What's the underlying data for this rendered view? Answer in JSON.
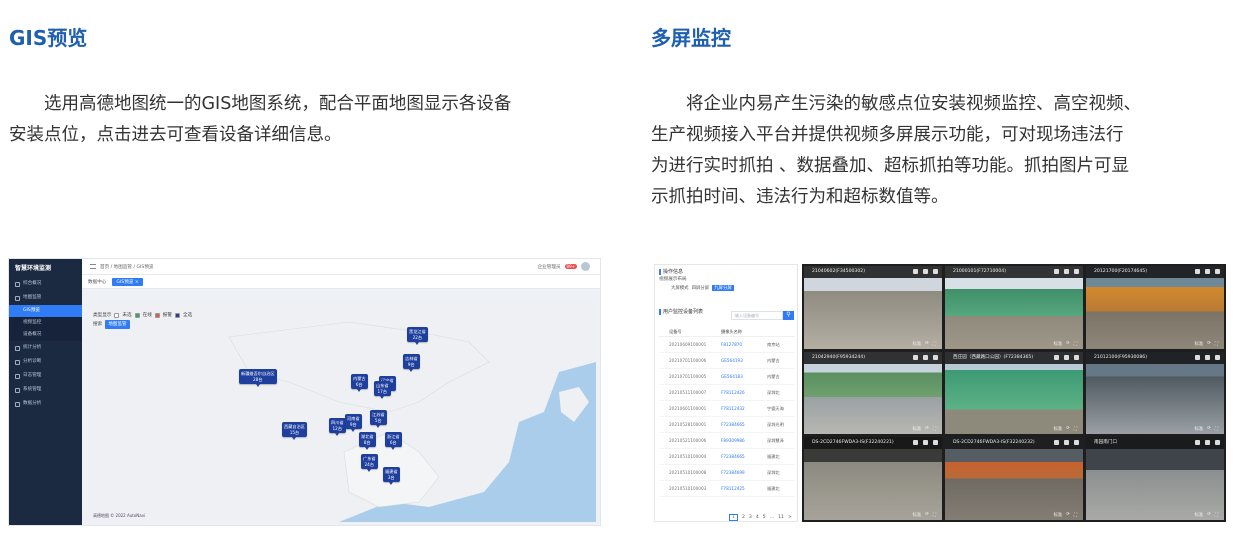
{
  "sections": {
    "gis": {
      "title": "GIS预览",
      "desc_line1": "选用高德地图统一的GIS地图系统，配合平面地图显示各设备",
      "desc_line2": "安装点位，点击进去可查看设备详细信息。"
    },
    "multi": {
      "title": "多屏监控",
      "desc_line1": "将企业内易产生污染的敏感点位安装视频监控、高空视频、",
      "desc_line2": "生产视频接入平台并提供视频多屏展示功能，可对现场违法行",
      "desc_line3": "为进行实时抓拍 、数据叠加、超标抓拍等功能。抓拍图片可显",
      "desc_line4": "示抓拍时间、违法行为和超标数值等。"
    }
  },
  "gis_ui": {
    "logo": "智慧环境监测",
    "menu": [
      {
        "label": "综合概况"
      },
      {
        "label": "地图监管"
      },
      {
        "label": "GIS预览",
        "sub": true,
        "active": true
      },
      {
        "label": "视频监控",
        "sub": true
      },
      {
        "label": "设备概况",
        "sub": true
      },
      {
        "label": "统计分析"
      },
      {
        "label": "分析诊断"
      },
      {
        "label": "日志管理"
      },
      {
        "label": "系统管理"
      },
      {
        "label": "数据分析"
      }
    ],
    "breadcrumb": "首页 / 地图监管 / GIS预览",
    "topbar_user": "企业管理员",
    "topbar_badge": "99+",
    "tab_home": "数据中心",
    "tab_active": "GIS预览 ×",
    "filter_label": "类型显示",
    "filter_items": [
      "未选",
      "在线",
      "报警",
      "全选"
    ],
    "filter_label2": "搜索",
    "filter_btn": "地图监管",
    "markers": [
      {
        "l1": "黑龙江省",
        "l2": "22台"
      },
      {
        "l1": "吉林省",
        "l2": "9台"
      },
      {
        "l1": "新疆维吾尔自治区",
        "l2": "28台"
      },
      {
        "l1": "内蒙古",
        "l2": "6台"
      },
      {
        "l1": "辽宁省",
        "l2": "4台"
      },
      {
        "l1": "山东省",
        "l2": "17台"
      },
      {
        "l1": "西藏自治区",
        "l2": "15台"
      },
      {
        "l1": "四川省",
        "l2": "12台"
      },
      {
        "l1": "河南省",
        "l2": "9台"
      },
      {
        "l1": "江苏省",
        "l2": "5台"
      },
      {
        "l1": "湖北省",
        "l2": "8台"
      },
      {
        "l1": "浙江省",
        "l2": "6台"
      },
      {
        "l1": "广东省",
        "l2": "24台"
      },
      {
        "l1": "福建省",
        "l2": "3台"
      }
    ],
    "footer": "高德地图 © 2022 AutoNavi"
  },
  "ms_ui": {
    "panel_title": "操作信息",
    "layout_label": "视频展示布局",
    "layout_btns": [
      "大屏模式",
      "四屏分屏",
      "九屏分屏"
    ],
    "list_title": "用户监控设备列表",
    "search_placeholder": "输入设备编号",
    "col_code": "设备号",
    "col_cam": "摄像头名称",
    "rows": [
      {
        "code": "20210609100001",
        "cam": "F8127870",
        "name": "南京站"
      },
      {
        "code": "20210701100006",
        "cam": "GE564193",
        "name": "内蒙古"
      },
      {
        "code": "20210701100005",
        "cam": "GE564183",
        "name": "内蒙古"
      },
      {
        "code": "20210511100007",
        "cam": "F78112426",
        "name": "深圳北"
      },
      {
        "code": "20210601100001",
        "cam": "F78112432",
        "name": "宁德天海"
      },
      {
        "code": "20210528100001",
        "cam": "F72384665",
        "name": "深圳光明"
      },
      {
        "code": "20210521100006",
        "cam": "F89309986",
        "name": "深圳慧泽"
      },
      {
        "code": "20210510100004",
        "cam": "F72384665",
        "name": "福建北"
      },
      {
        "code": "20210510100008",
        "cam": "F72384699",
        "name": "深圳北"
      },
      {
        "code": "20210510100003",
        "cam": "F78112425",
        "name": "福建北"
      }
    ],
    "pager": [
      "1",
      "2",
      "3",
      "4",
      "5",
      "...",
      "11",
      ">"
    ],
    "cells": [
      {
        "title": "21040602(F34500302)",
        "foot": "标准"
      },
      {
        "title": "21000101(F72710004)",
        "foot": "标准"
      },
      {
        "title": "20121700(F20174645)",
        "foot": "标准"
      },
      {
        "title": "21042940(F95934244)",
        "foot": "标准"
      },
      {
        "title": "西庄园（西藏路口公园）(F72384365)",
        "foot": "标准"
      },
      {
        "title": "21012100(F95930086)",
        "foot": "标准"
      },
      {
        "title": "DS-2CD2746FWDA3-IS(F32240221)",
        "foot": "标准"
      },
      {
        "title": "DS-2CD2746FWDA3-IS(F32240232)",
        "foot": "标准"
      },
      {
        "title": "南园南门口",
        "foot": "标准"
      }
    ]
  },
  "colors": {
    "accent": "#2f7cf6",
    "title": "#1f5fb0",
    "sidebar": "#1b2a41",
    "marker": "#1e3f9e",
    "sea": "#a9cdea"
  }
}
